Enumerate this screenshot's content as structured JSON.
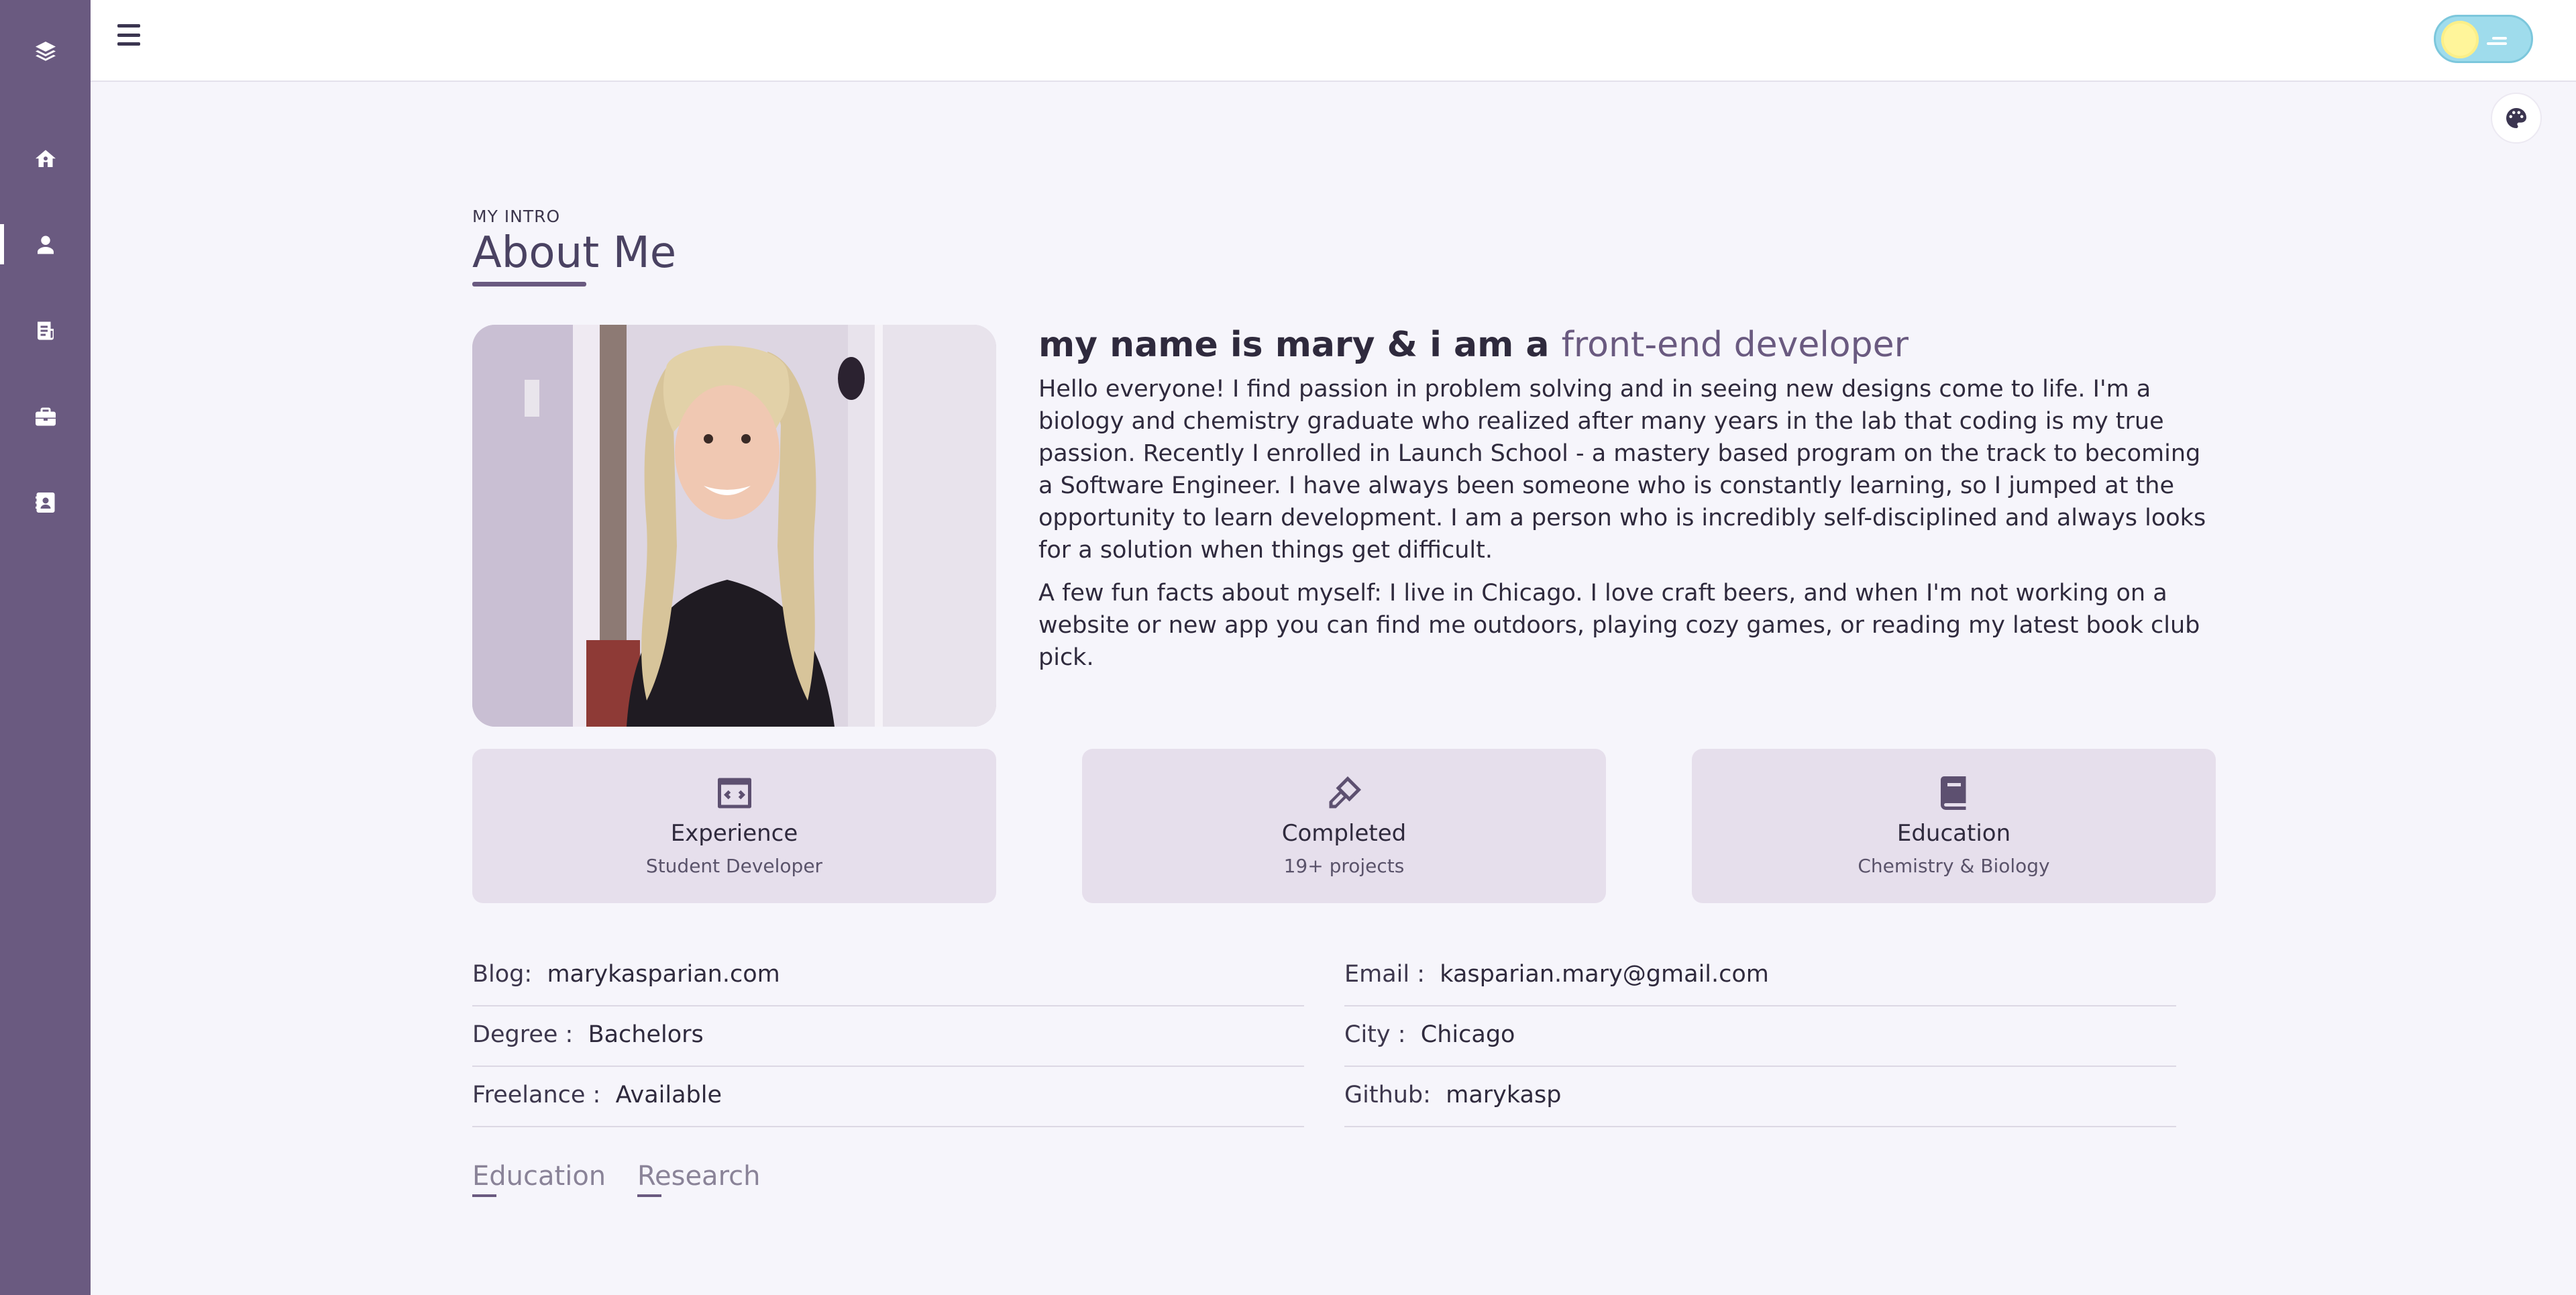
{
  "header": {
    "subtitle": "MY INTRO",
    "title": "About Me"
  },
  "sidebar": {
    "items": [
      {
        "name": "layers-icon"
      },
      {
        "name": "home-icon"
      },
      {
        "name": "user-icon",
        "active": true
      },
      {
        "name": "resume-icon"
      },
      {
        "name": "briefcase-icon"
      },
      {
        "name": "contact-icon"
      }
    ]
  },
  "intro": {
    "headline_prefix": "my name is mary & i am a",
    "headline_accent": "front-end developer",
    "paragraph1": "Hello everyone! I find passion in problem solving and in seeing new designs come to life. I'm a biology and chemistry graduate who realized after many years in the lab that coding is my true passion. Recently I enrolled in Launch School - a mastery based program on the track to becoming a Software Engineer. I have always been someone who is constantly learning, so I jumped at the opportunity to learn development. I am a person who is incredibly self-disciplined and always looks for a solution when things get difficult.",
    "paragraph2": "A few fun facts about myself: I live in Chicago. I love craft beers, and when I'm not working on a website or new app you can find me outdoors, playing cozy games, or reading my latest book club pick."
  },
  "cards": [
    {
      "title": "Experience",
      "subtitle": "Student Developer",
      "icon": "code-icon"
    },
    {
      "title": "Completed",
      "subtitle": "19+ projects",
      "icon": "brush-icon"
    },
    {
      "title": "Education",
      "subtitle": "Chemistry & Biology",
      "icon": "book-icon"
    }
  ],
  "info": {
    "blog_label": "Blog:",
    "blog_value": "marykasparian.com",
    "email_label": "Email :",
    "email_value": "kasparian.mary@gmail.com",
    "degree_label": "Degree :",
    "degree_value": "Bachelors",
    "city_label": "City :",
    "city_value": "Chicago",
    "freelance_label": "Freelance :",
    "freelance_value": "Available",
    "github_label": "Github:",
    "github_value": "marykasp"
  },
  "tabs": {
    "education": "Education",
    "research": "Research"
  },
  "colors": {
    "sidebar": "#6a5a80",
    "accent": "#6a5a80",
    "card_bg": "#e6dfec",
    "toggle_bg": "#9fdcec",
    "sun": "#fff59a"
  }
}
